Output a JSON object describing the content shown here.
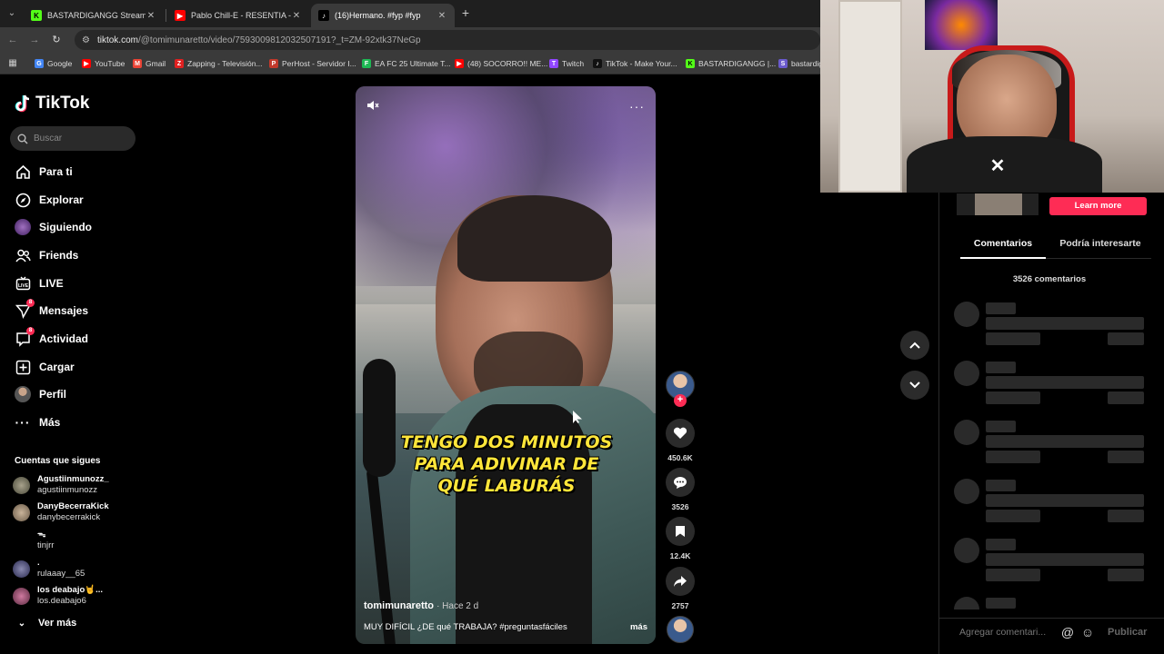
{
  "browser": {
    "tabs": [
      {
        "title": "BASTARDIGANGG Stream - Wa",
        "fav": "K",
        "fav_color": "#53fc18"
      },
      {
        "title": "Pablo Chill-E - RESENTIA - You",
        "fav": "▶",
        "fav_color": "#ff0000"
      },
      {
        "title": "(16)Hermano. #fyp #fyp",
        "fav": "♪",
        "fav_color": "#000000"
      }
    ],
    "url_domain": "tiktok.com",
    "url_path": "/@tomimunaretto/video/7593009812032507191?_t=ZM-92xtk37NeGp",
    "bookmarks": [
      {
        "label": "Google",
        "color": "#4285f4",
        "glyph": "G"
      },
      {
        "label": "YouTube",
        "color": "#ff0000",
        "glyph": "▶"
      },
      {
        "label": "Gmail",
        "color": "#ea4335",
        "glyph": "M"
      },
      {
        "label": "Zapping - Televisión...",
        "color": "#e02020",
        "glyph": "Z"
      },
      {
        "label": "PerHost - Servidor I...",
        "color": "#c0392b",
        "glyph": "P"
      },
      {
        "label": "EA FC 25 Ultimate T...",
        "color": "#1db954",
        "glyph": "F"
      },
      {
        "label": "(48) SOCORRO!! ME...",
        "color": "#ff0000",
        "glyph": "▶"
      },
      {
        "label": "Twitch",
        "color": "#9146ff",
        "glyph": "T"
      },
      {
        "label": "TikTok - Make Your...",
        "color": "#111111",
        "glyph": "♪"
      },
      {
        "label": "BASTARDIGANGG |...",
        "color": "#53fc18",
        "glyph": "K"
      },
      {
        "label": "bastardig",
        "color": "#6a5acd",
        "glyph": "S"
      }
    ]
  },
  "tiktok": {
    "logo": "TikTok",
    "search_placeholder": "Buscar",
    "nav": [
      {
        "label": "Para ti",
        "icon": "home-icon"
      },
      {
        "label": "Explorar",
        "icon": "compass-icon"
      },
      {
        "label": "Siguiendo",
        "icon": "following-avatar-icon"
      },
      {
        "label": "Friends",
        "icon": "friends-icon"
      },
      {
        "label": "LIVE",
        "icon": "live-icon"
      },
      {
        "label": "Mensajes",
        "icon": "messages-icon",
        "badge": "8"
      },
      {
        "label": "Actividad",
        "icon": "activity-icon",
        "badge": "8"
      },
      {
        "label": "Cargar",
        "icon": "upload-icon"
      },
      {
        "label": "Perfil",
        "icon": "profile-avatar-icon"
      },
      {
        "label": "Más",
        "icon": "more-icon"
      }
    ],
    "following_title": "Cuentas que sigues",
    "following": [
      {
        "name": "Agustiinmunozz_",
        "handle": "agustiinmunozz"
      },
      {
        "name": "DanyBecerraKick",
        "handle": "danybecerrakick"
      },
      {
        "name": "ᯓ",
        "handle": "tinjrr"
      },
      {
        "name": ".",
        "handle": "rulaaay__65"
      },
      {
        "name": "los deabajo🤘...",
        "handle": "los.deabajo6"
      }
    ],
    "see_more": "Ver más"
  },
  "video": {
    "caption": "TENGO DOS MINUTOS PARA ADIVINAR DE QUÉ LABURÁS",
    "author": "tomimunaretto",
    "ago": "· Hace 2 d",
    "description": "MUY DIFÍCIL ¿DE qué TRABAJA? #preguntasfáciles",
    "more": "más",
    "likes": "450.6K",
    "comments": "3526",
    "saves": "12.4K",
    "shares": "2757"
  },
  "right_panel": {
    "learn_more": "Learn more",
    "tab_comments": "Comentarios",
    "tab_interest": "Podría interesarte",
    "comment_count": "3526 comentarios",
    "input_placeholder": "Agregar comentari...",
    "publish": "Publicar"
  },
  "colors": {
    "accent": "#fe2c55",
    "caption": "#ffe63a"
  }
}
